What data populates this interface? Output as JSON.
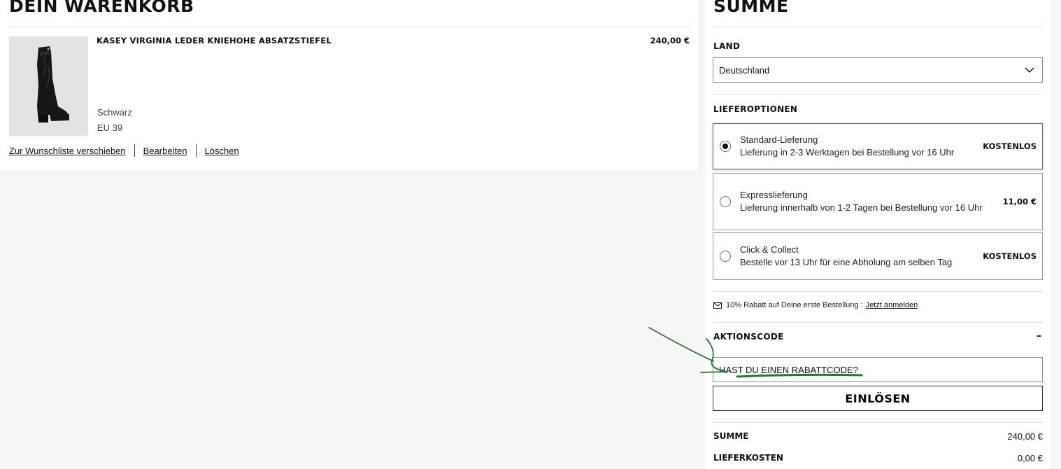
{
  "cart": {
    "title": "DEIN WARENKORB",
    "item": {
      "name": "KASEY VIRGINIA LEDER KNIEHOHE ABSATZSTIEFEL",
      "price": "240,00 €",
      "color": "Schwarz",
      "size": "EU 39",
      "image_icon": "boot-product-image"
    },
    "actions": {
      "wishlist": "Zur Wunschliste verschieben",
      "edit": "Bearbeiten",
      "delete": "Löschen"
    }
  },
  "summary": {
    "title": "SUMME",
    "country_label": "LAND",
    "country_value": "Deutschland",
    "delivery_label": "LIEFEROPTIONEN",
    "options": [
      {
        "name": "Standard-Lieferung",
        "desc": "Lieferung in 2-3 Werktagen bei Bestellung vor 16 Uhr",
        "price": "KOSTENLOS",
        "selected": true
      },
      {
        "name": "Expresslieferung",
        "desc": "Lieferung innerhalb von 1-2 Tagen bei Bestellung vor 16 Uhr",
        "price": "11,00 €",
        "selected": false
      },
      {
        "name": "Click & Collect",
        "desc": "Bestelle vor 13 Uhr für eine Abholung am selben Tag",
        "price": "KOSTENLOS",
        "selected": false
      }
    ],
    "promo_text": "10% Rabatt auf Deine erste Bestellung :",
    "promo_link": "Jetzt anmelden",
    "action_code_label": "AKTIONSCODE",
    "collapse_symbol": "–",
    "code_placeholder": "HAST DU EINEN RABATTCODE?",
    "redeem_label": "EINLÖSEN",
    "totals": [
      {
        "label": "SUMME",
        "value": "240,00 €"
      },
      {
        "label": "LIEFERKOSTEN",
        "value": "0,00 €"
      }
    ]
  },
  "colors": {
    "annotation": "#1f7a2e",
    "border": "#dedede"
  }
}
